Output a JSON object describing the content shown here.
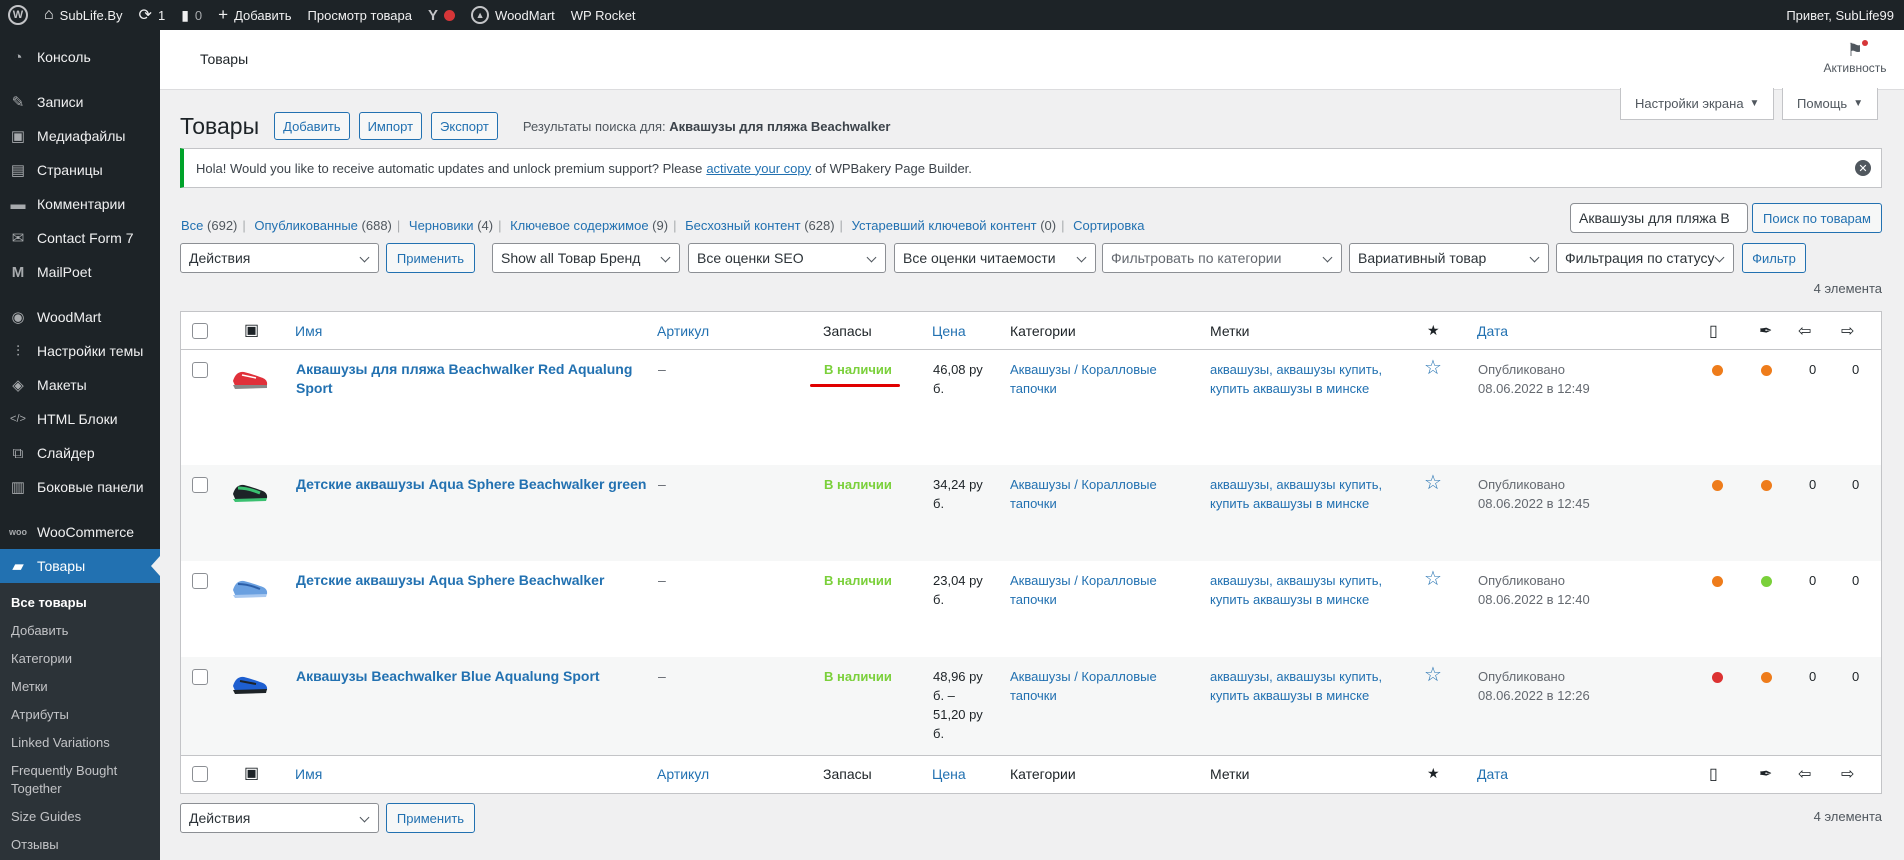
{
  "adminbar": {
    "site": "SubLife.By",
    "updates": "1",
    "comments": "0",
    "add": "Добавить",
    "view": "Просмотр товара",
    "woodmart": "WoodMart",
    "rocket": "WP Rocket",
    "greeting": "Привет, SubLife99"
  },
  "sidebar": {
    "items": [
      {
        "label": "Консоль",
        "icon": "dashboard-icon"
      },
      {
        "label": "Записи",
        "icon": "pin-icon"
      },
      {
        "label": "Медиафайлы",
        "icon": "media-icon"
      },
      {
        "label": "Страницы",
        "icon": "page-icon"
      },
      {
        "label": "Комментарии",
        "icon": "comment-icon"
      },
      {
        "label": "Contact Form 7",
        "icon": "mail-icon"
      },
      {
        "label": "MailPoet",
        "icon": "mailpoet-icon"
      },
      {
        "label": "WoodMart",
        "icon": "woodmart-icon"
      },
      {
        "label": "Настройки темы",
        "icon": "sliders-icon"
      },
      {
        "label": "Макеты",
        "icon": "layers-icon"
      },
      {
        "label": "HTML Блоки",
        "icon": "html-icon"
      },
      {
        "label": "Слайдер",
        "icon": "slider-icon"
      },
      {
        "label": "Боковые панели",
        "icon": "sidebar-icon"
      },
      {
        "label": "WooCommerce",
        "icon": "woo-icon"
      },
      {
        "label": "Товары",
        "icon": "products-icon"
      }
    ],
    "submenu": [
      "Все товары",
      "Добавить",
      "Категории",
      "Метки",
      "Атрибуты",
      "Linked Variations",
      "Frequently Bought Together",
      "Size Guides",
      "Отзывы"
    ]
  },
  "topstrip": {
    "title": "Товары",
    "activity": "Активность"
  },
  "screen_options": "Настройки экрана",
  "help": "Помощь",
  "heading": {
    "title": "Товары",
    "add": "Добавить",
    "import": "Импорт",
    "export": "Экспорт",
    "search_prefix": "Результаты поиска для:",
    "search_query": "Аквашузы для пляжа Beachwalker"
  },
  "notice": {
    "before": "Hola! Would you like to receive automatic updates and unlock premium support? Please",
    "link": "activate your copy",
    "after": "of WPBakery Page Builder."
  },
  "views": [
    {
      "label": "Все",
      "count": "(692)"
    },
    {
      "label": "Опубликованные",
      "count": "(688)"
    },
    {
      "label": "Черновики",
      "count": "(4)"
    },
    {
      "label": "Ключевое содержимое",
      "count": "(9)"
    },
    {
      "label": "Бесхозный контент",
      "count": "(628)"
    },
    {
      "label": "Устаревший ключевой контент",
      "count": "(0)"
    },
    {
      "label": "Сортировка",
      "count": ""
    }
  ],
  "search": {
    "value": "Аквашузы для пляжа B",
    "button": "Поиск по товарам"
  },
  "filters": {
    "bulk": "Действия",
    "apply": "Применить",
    "brand": "Show all Товар Бренд",
    "seo": "Все оценки SEO",
    "readability": "Все оценки читаемости",
    "category": "Фильтровать по категории",
    "type": "Вариативный товар",
    "stock": "Фильтрация по статусу",
    "filter_btn": "Фильтр",
    "count": "4 элемента"
  },
  "columns": {
    "name": "Имя",
    "sku": "Артикул",
    "stock": "Запасы",
    "price": "Цена",
    "categories": "Категории",
    "tags": "Метки",
    "date": "Дата"
  },
  "rows": [
    {
      "name_l1": "Аквашузы для пляжа Beachwalker Red Aqualung",
      "name_l2": "Sport",
      "sku": "–",
      "stock": "В наличии",
      "price": [
        "46,08 ру",
        "б."
      ],
      "cat_l1": "Аквашузы / Коралловые",
      "cat_l2": "тапочки",
      "tags_l1": "аквашузы, аквашузы купить,",
      "tags_l2": "купить аквашузы в минске",
      "status": "Опубликовано",
      "date": "08.06.2022 в 12:49",
      "seo_color": "#ee7c1b",
      "read_color": "#ee7c1b",
      "links_in": "0",
      "links_out": "0",
      "shoe_color": "#e0303a"
    },
    {
      "name_l1": "Детские аквашузы Aqua Sphere Beachwalker green",
      "name_l2": "",
      "sku": "–",
      "stock": "В наличии",
      "price": [
        "34,24 ру",
        "б."
      ],
      "cat_l1": "Аквашузы / Коралловые",
      "cat_l2": "тапочки",
      "tags_l1": "аквашузы, аквашузы купить,",
      "tags_l2": "купить аквашузы в минске",
      "status": "Опубликовано",
      "date": "08.06.2022 в 12:45",
      "seo_color": "#ee7c1b",
      "read_color": "#ee7c1b",
      "links_in": "0",
      "links_out": "0",
      "shoe_color": "#3aa860"
    },
    {
      "name_l1": "Детские аквашузы Aqua Sphere Beachwalker",
      "name_l2": "",
      "sku": "–",
      "stock": "В наличии",
      "price": [
        "23,04 ру",
        "б."
      ],
      "cat_l1": "Аквашузы / Коралловые",
      "cat_l2": "тапочки",
      "tags_l1": "аквашузы, аквашузы купить,",
      "tags_l2": "купить аквашузы в минске",
      "status": "Опубликовано",
      "date": "08.06.2022 в 12:40",
      "seo_color": "#ee7c1b",
      "read_color": "#7ad03a",
      "links_in": "0",
      "links_out": "0",
      "shoe_color": "#5b8fd6"
    },
    {
      "name_l1": "Аквашузы Beachwalker Blue Aqualung Sport",
      "name_l2": "",
      "sku": "–",
      "stock": "В наличии",
      "price": [
        "48,96 ру",
        "б. –",
        "51,20 ру",
        "б."
      ],
      "cat_l1": "Аквашузы / Коралловые",
      "cat_l2": "тапочки",
      "tags_l1": "аквашузы, аквашузы купить,",
      "tags_l2": "купить аквашузы в минске",
      "status": "Опубликовано",
      "date": "08.06.2022 в 12:26",
      "seo_color": "#dc3232",
      "read_color": "#ee7c1b",
      "links_in": "0",
      "links_out": "0",
      "shoe_color": "#1e5fd0"
    }
  ]
}
